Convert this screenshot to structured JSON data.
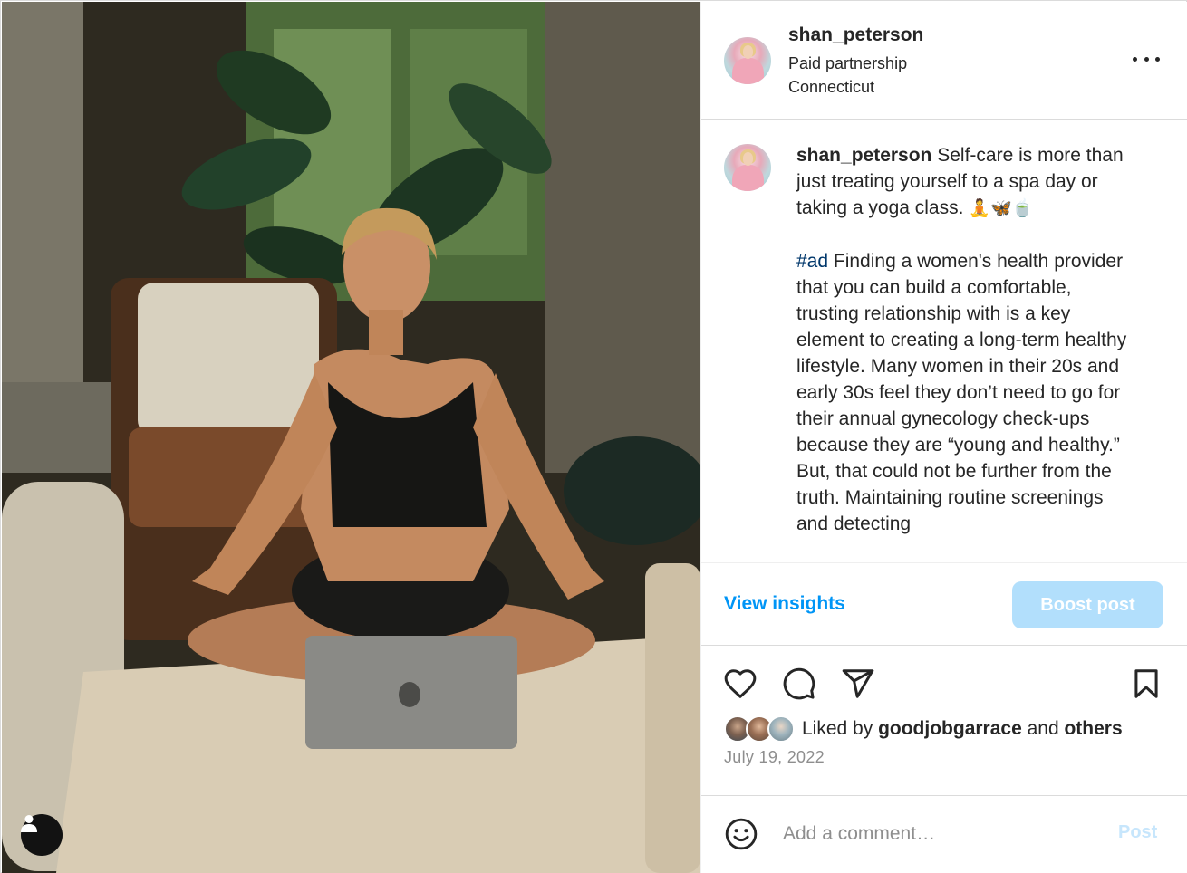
{
  "post": {
    "username": "shan_peterson",
    "partnership": "Paid partnership",
    "location": "Connecticut",
    "caption": {
      "username": "shan_peterson",
      "intro": " Self-care is more than just treating yourself to a spa day or taking a yoga class. ",
      "emojis": "🧘🦋🍵",
      "hashtag": "#ad",
      "body": " Finding a women's health provider that you can build a comfortable, trusting relationship with is a key element to creating a long-term healthy lifestyle. Many women in their 20s and early 30s feel they don’t need to go for their annual gynecology check-ups because they are “young and healthy.” But, that could not be further from the truth. Maintaining routine screenings and detecting"
    },
    "insights_label": "View insights",
    "boost_label": "Boost post",
    "likes": {
      "prefix": "Liked by ",
      "user": "goodjobgarrace",
      "connector": " and ",
      "others": "others"
    },
    "date": "July 19, 2022",
    "comment": {
      "placeholder": "Add a comment…",
      "post_label": "Post"
    }
  },
  "icons": {
    "more": "more-options-icon",
    "like": "heart-icon",
    "comment": "comment-icon",
    "share": "share-icon",
    "save": "bookmark-icon",
    "emoji": "smiley-icon",
    "tag": "user-tag-icon"
  },
  "colors": {
    "accent": "#0095f6",
    "boost_bg": "#b2dffc",
    "hashtag": "#00376b",
    "muted": "#8e8e8e"
  }
}
